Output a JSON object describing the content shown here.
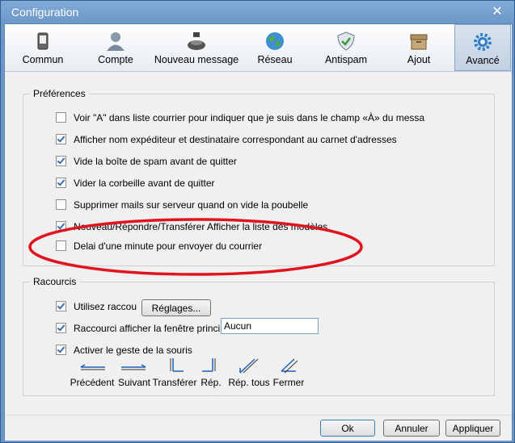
{
  "window": {
    "title": "Configuration"
  },
  "tabs": [
    {
      "label": "Commun",
      "icon": "phone-icon"
    },
    {
      "label": "Compte",
      "icon": "user-icon"
    },
    {
      "label": "Nouveau message",
      "icon": "inkwell-icon"
    },
    {
      "label": "Réseau",
      "icon": "globe-icon"
    },
    {
      "label": "Antispam",
      "icon": "shield-icon"
    },
    {
      "label": "Ajout",
      "icon": "box-icon"
    },
    {
      "label": "Avancé",
      "icon": "gear-icon",
      "selected": true
    }
  ],
  "preferences": {
    "label": "Préférences",
    "items": [
      {
        "text": "Voir \"A\" dans liste courrier pour indiquer que je suis dans le champ «À» du messa",
        "checked": false
      },
      {
        "text": "Afficher nom expéditeur et destinataire correspondant au carnet d'adresses",
        "checked": true
      },
      {
        "text": "Vide la boîte de spam avant de quitter",
        "checked": true
      },
      {
        "text": "Vider la corbeille avant de quitter",
        "checked": true
      },
      {
        "text": "Supprimer mails sur serveur quand on vide la poubelle",
        "checked": false
      },
      {
        "text": "Nouveau/Répondre/Transférer Afficher la liste des modèles.",
        "checked": true
      },
      {
        "text": "Delai d'une minute pour envoyer du courrier",
        "checked": false
      }
    ]
  },
  "shortcuts": {
    "label": "Racourcis",
    "use_shortcut": "Utilisez raccou",
    "settings_button": "Réglages...",
    "show_window": "Raccourci afficher la fenêtre princi",
    "show_window_value": "Aucun",
    "mouse_gesture": "Activer le geste de la souris",
    "gestures": [
      "Précédent",
      "Suivant",
      "Transférer",
      "Rép.",
      "Rép. tous",
      "Fermer"
    ]
  },
  "buttons": {
    "ok": "Ok",
    "cancel": "Annuler",
    "apply": "Appliquer"
  },
  "colors": {
    "title_bar": "#6b96c6",
    "annotation": "#e0141e",
    "check": "#3b6fb0"
  }
}
